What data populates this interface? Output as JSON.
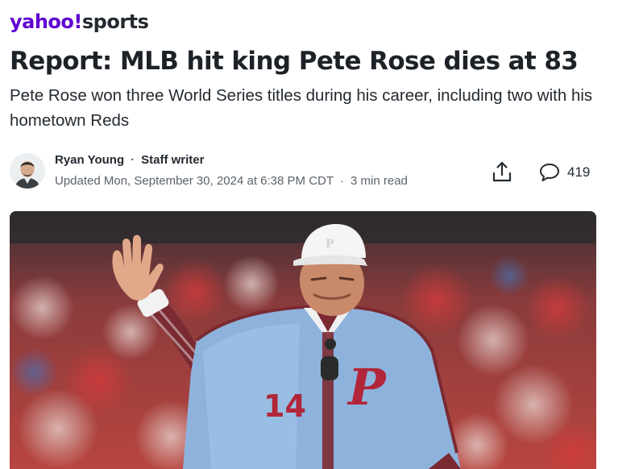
{
  "brand": {
    "logo_yahoo": "yahoo",
    "logo_bang": "!",
    "logo_section": "sports",
    "color_primary": "#6001d2"
  },
  "article": {
    "headline": "Report: MLB hit king Pete Rose dies at 83",
    "subheadline": "Pete Rose won three World Series titles during his career, including two with his hometown Reds"
  },
  "author": {
    "name": "Ryan Young",
    "role": "Staff writer",
    "avatar_icon": "author-avatar"
  },
  "meta": {
    "updated": "Updated Mon, September 30, 2024 at 6:38 PM CDT",
    "read_time": "3 min read"
  },
  "actions": {
    "share_icon": "share-icon",
    "comment_icon": "comment-icon",
    "comment_count": "419"
  },
  "hero_image": {
    "jersey_number": "14",
    "jersey_logo": "P"
  }
}
